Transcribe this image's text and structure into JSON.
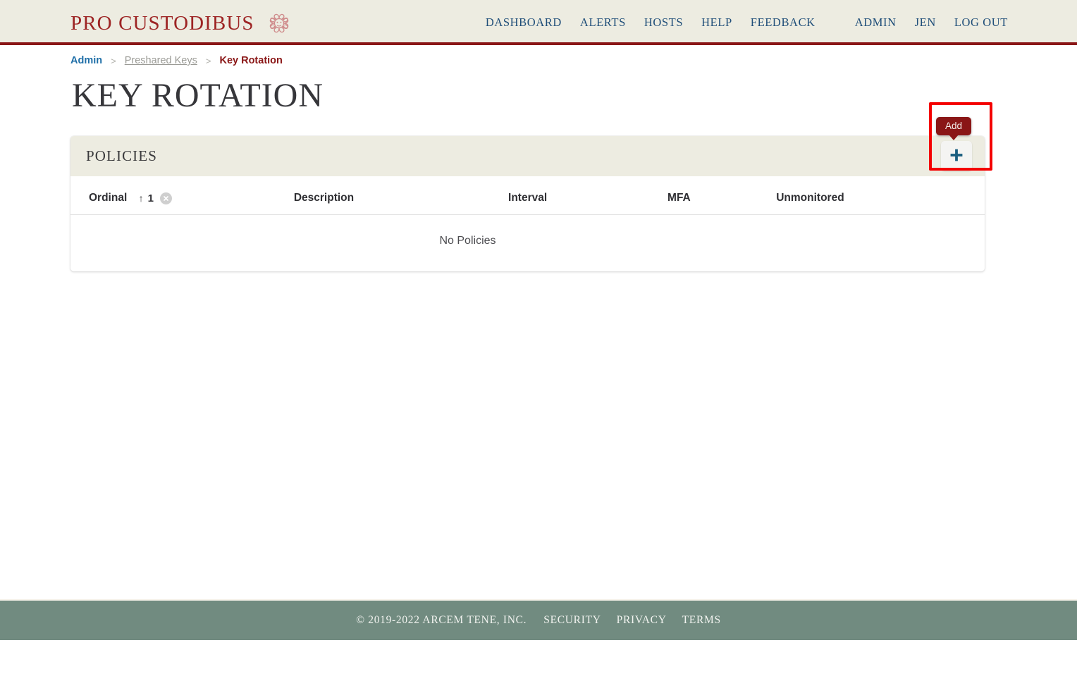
{
  "header": {
    "brand_text": "PRO CUSTODIBUS",
    "brand_emblem": "medusa-emblem-icon",
    "nav": [
      {
        "label": "DASHBOARD",
        "name": "nav-dashboard"
      },
      {
        "label": "ALERTS",
        "name": "nav-alerts"
      },
      {
        "label": "HOSTS",
        "name": "nav-hosts"
      },
      {
        "label": "HELP",
        "name": "nav-help"
      },
      {
        "label": "FEEDBACK",
        "name": "nav-feedback"
      },
      {
        "label": "ADMIN",
        "name": "nav-admin"
      },
      {
        "label": "JEN",
        "name": "nav-user"
      },
      {
        "label": "LOG OUT",
        "name": "nav-logout"
      }
    ]
  },
  "breadcrumb": {
    "root": "Admin",
    "sep1": ">",
    "middle": "Preshared Keys",
    "sep2": ">",
    "current": "Key Rotation"
  },
  "page": {
    "title": "KEY ROTATION"
  },
  "card": {
    "title": "POLICIES",
    "add_tooltip": "Add",
    "add_icon": "plus-icon"
  },
  "table": {
    "columns": [
      {
        "label": "Ordinal",
        "name": "column-ordinal"
      },
      {
        "label": "Description",
        "name": "column-description"
      },
      {
        "label": "Interval",
        "name": "column-interval"
      },
      {
        "label": "MFA",
        "name": "column-mfa"
      },
      {
        "label": "Unmonitored",
        "name": "column-unmonitored"
      }
    ],
    "sort": {
      "arrow": "↑",
      "rank": "1",
      "clear_icon": "close-circle-icon"
    },
    "rows": [],
    "empty_message": "No Policies"
  },
  "footer": {
    "copyright": "© 2019-2022 ARCEM TENE, INC.",
    "links": [
      {
        "label": "SECURITY",
        "name": "footer-link-security"
      },
      {
        "label": "PRIVACY",
        "name": "footer-link-privacy"
      },
      {
        "label": "TERMS",
        "name": "footer-link-terms"
      }
    ]
  },
  "colors": {
    "brand_red": "#9d2424",
    "header_bg": "#edece1",
    "header_rule": "#8a1616",
    "nav_link": "#1f4e79",
    "footer_bg": "#718b80",
    "highlight": "#f40000",
    "plus_blue": "#1b5f80",
    "tooltip_bg": "#8a1616"
  }
}
